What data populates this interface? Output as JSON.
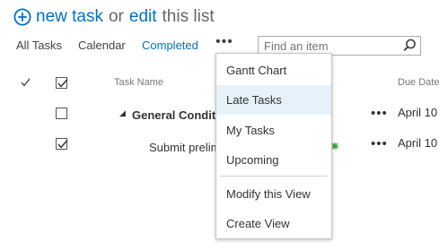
{
  "header": {
    "new_task": "new task",
    "or": "or",
    "edit": "edit",
    "this_list": "this list"
  },
  "views": {
    "tabs": [
      "All Tasks",
      "Calendar",
      "Completed"
    ],
    "selected": "Completed",
    "more": "•••"
  },
  "search": {
    "placeholder": "Find an item"
  },
  "table": {
    "columns": {
      "check_icon": "check-icon",
      "task_name": "Task Name",
      "due_date": "Due Date"
    },
    "rows": [
      {
        "name": "General Conditi",
        "prefix": "◢",
        "due": "April 10",
        "checked": false
      },
      {
        "name": "Submit prelim",
        "due": "April 10",
        "checked": true
      }
    ],
    "row_more": "•••"
  },
  "menu": {
    "items": [
      "Gantt Chart",
      "Late Tasks",
      "My Tasks",
      "Upcoming",
      "Modify this View",
      "Create View"
    ],
    "highlighted": "Late Tasks"
  },
  "colors": {
    "accent": "#0072c6",
    "menu_highlight": "#e6f2fa",
    "partial_marker": "#35a335"
  }
}
